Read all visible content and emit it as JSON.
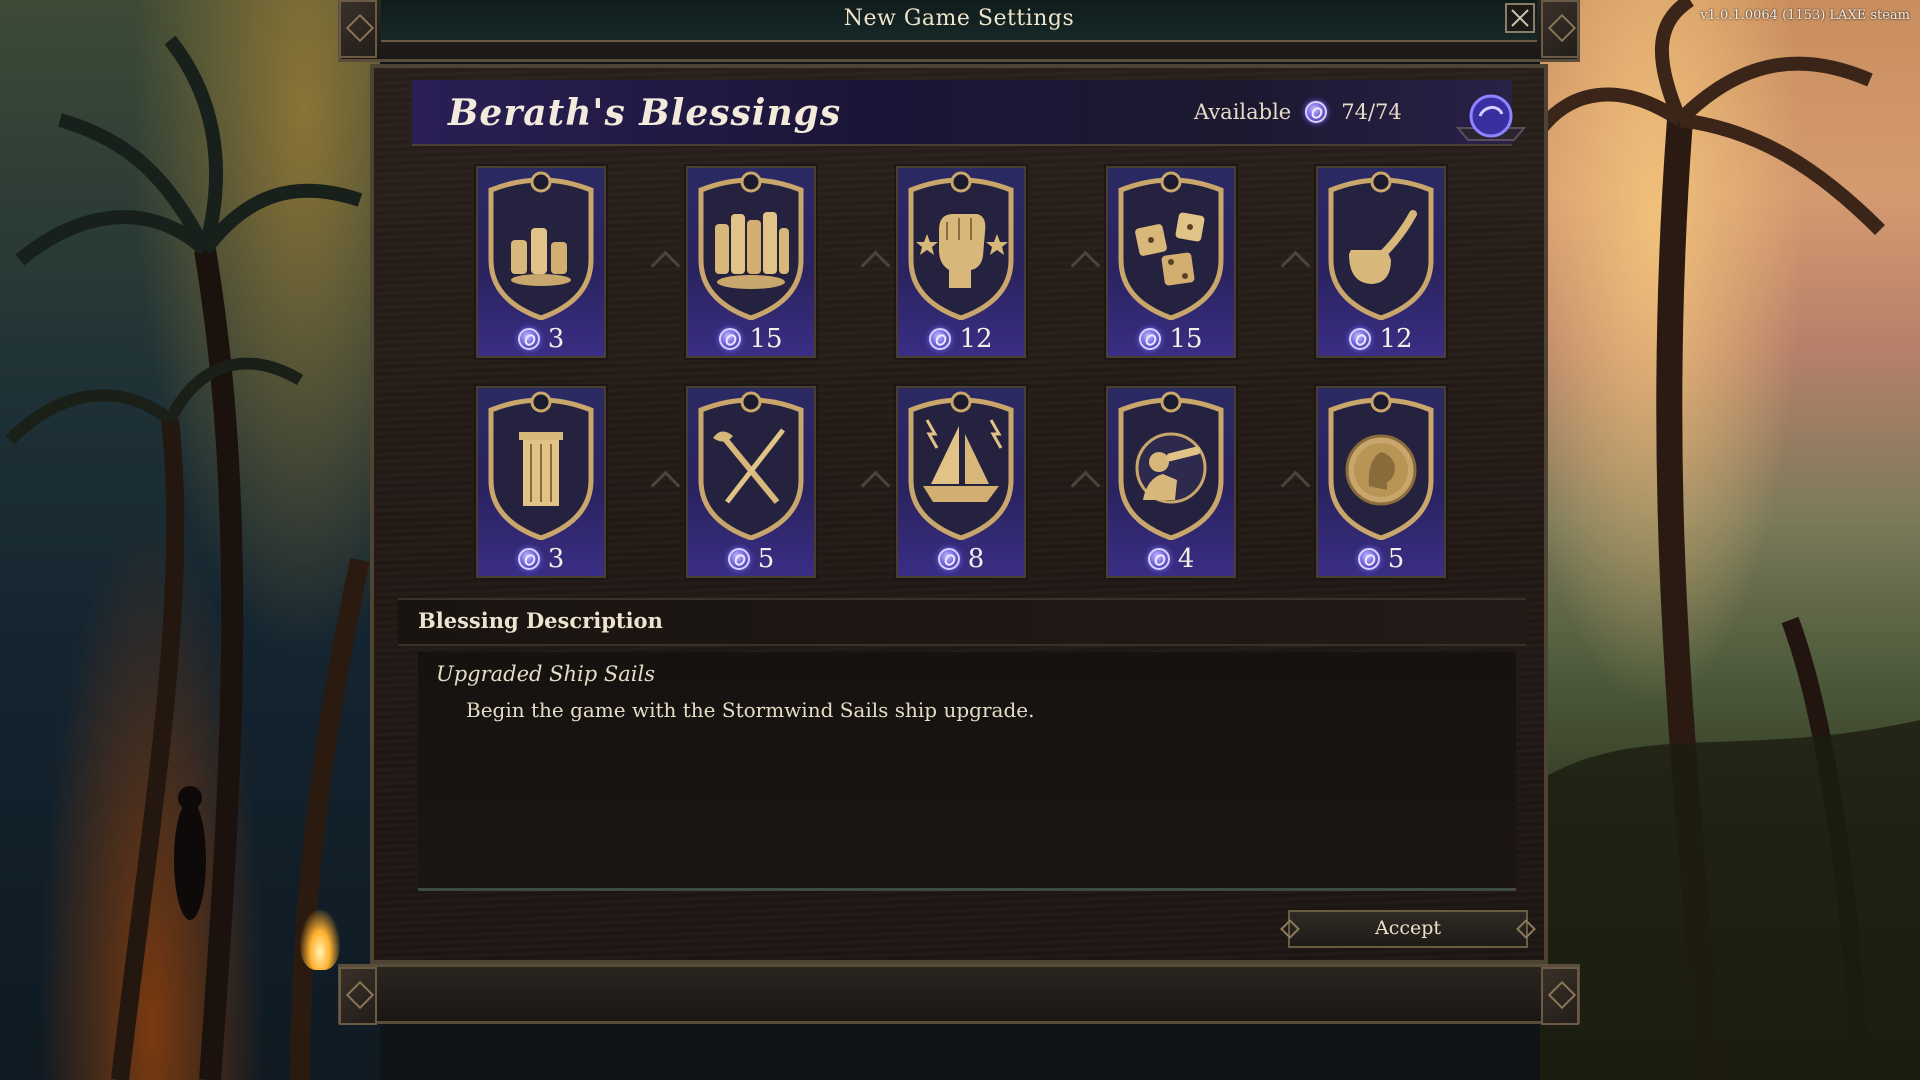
{
  "version_text": "v1.0.1.0064 (1153)  LAXE  steam",
  "window": {
    "title": "New Game Settings",
    "close_icon": "close-icon"
  },
  "panel": {
    "title": "Berath's Blessings",
    "available_label": "Available",
    "available_value": "74/74",
    "currency_icon": "blessing-point-icon"
  },
  "blessings": [
    {
      "icon": "small-coin-pile-icon",
      "cost": "3"
    },
    {
      "icon": "large-coin-pile-icon",
      "cost": "15"
    },
    {
      "icon": "raised-fist-icon",
      "cost": "12"
    },
    {
      "icon": "dice-icon",
      "cost": "15"
    },
    {
      "icon": "pipe-icon",
      "cost": "12"
    },
    {
      "icon": "column-icon",
      "cost": "3"
    },
    {
      "icon": "crossed-weapons-icon",
      "cost": "5"
    },
    {
      "icon": "sailing-ship-icon",
      "cost": "8"
    },
    {
      "icon": "spyglass-explorer-icon",
      "cost": "4"
    },
    {
      "icon": "medallion-portrait-icon",
      "cost": "5"
    }
  ],
  "description": {
    "header": "Blessing Description",
    "title": "Upgraded Ship Sails",
    "text": "Begin the game with the Stormwind Sails ship upgrade."
  },
  "accept_label": "Accept",
  "colors": {
    "accent_purple": "#7a6ae0",
    "card_purple": "#2a2360",
    "gold": "#c9a66b"
  }
}
